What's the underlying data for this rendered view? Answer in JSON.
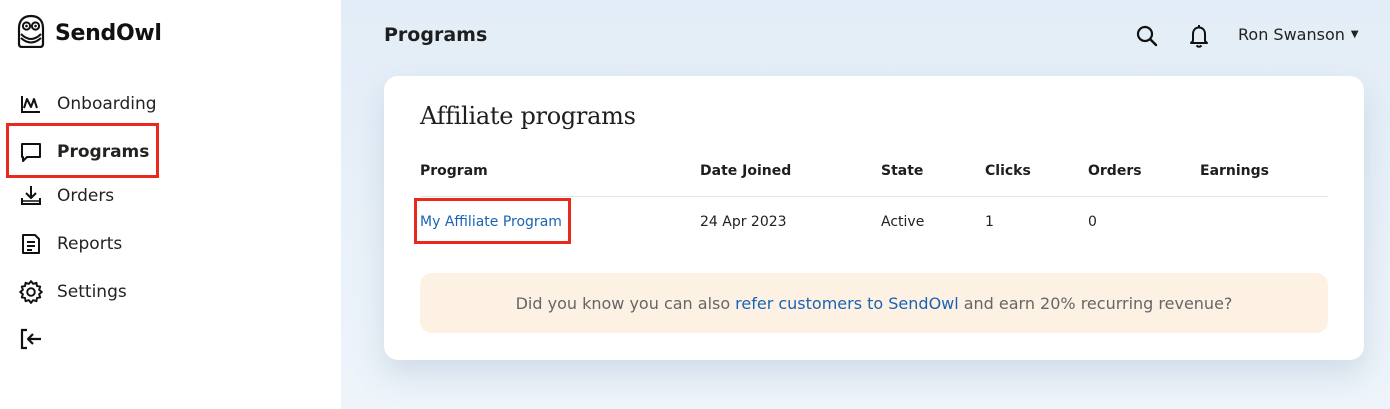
{
  "app": {
    "name": "SendOwl"
  },
  "sidebar": {
    "items": [
      {
        "label": "Onboarding",
        "icon": "onboarding-chart-icon"
      },
      {
        "label": "Programs",
        "icon": "chat-bubble-icon",
        "active": true
      },
      {
        "label": "Orders",
        "icon": "download-tray-icon"
      },
      {
        "label": "Reports",
        "icon": "report-document-icon"
      },
      {
        "label": "Settings",
        "icon": "gear-icon"
      },
      {
        "label": "",
        "icon": "logout-icon"
      }
    ]
  },
  "header": {
    "title": "Programs",
    "user_name": "Ron Swanson",
    "icons": [
      "search-icon",
      "bell-icon",
      "chevron-down-icon"
    ]
  },
  "card": {
    "title": "Affiliate programs",
    "columns": [
      "Program",
      "Date Joined",
      "State",
      "Clicks",
      "Orders",
      "Earnings"
    ],
    "rows": [
      {
        "program": "My Affiliate Program",
        "date_joined": "24 Apr 2023",
        "state": "Active",
        "clicks": "1",
        "orders": "0",
        "earnings": ""
      }
    ],
    "notice": {
      "before": "Did you know you can also",
      "link": "refer customers to SendOwl",
      "after": "and earn 20% recurring revenue?"
    }
  },
  "colors": {
    "accent_link": "#1a63b3",
    "highlight_box": "#e8291c",
    "notice_bg": "#fdf1e3",
    "main_bg": "#e6eff8"
  }
}
